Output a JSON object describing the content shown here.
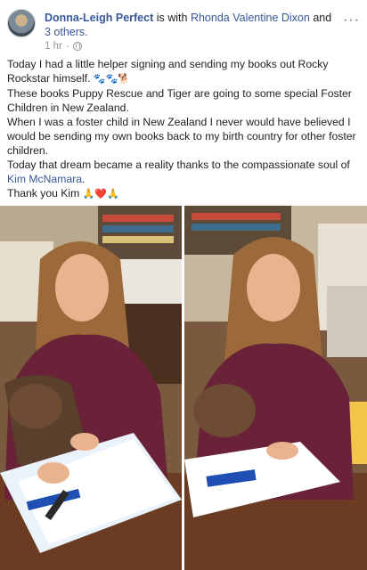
{
  "post": {
    "author": "Donna-Leigh Perfect",
    "with_text": "is with",
    "tagged_name": "Rhonda Valentine Dixon",
    "and_text": "and",
    "others_text": "3 others.",
    "timestamp": "1 hr",
    "separator": "·",
    "more_label": "···",
    "paragraphs": {
      "p1": "Today I had a little helper signing and sending my books out Rocky Rockstar himself.",
      "p1_emoji": "🐾🐾🐕",
      "p2": "These books Puppy Rescue and Tiger are going to some special Foster Children in New Zealand.",
      "p3": "When I was a foster child in New Zealand I never would have believed I would be sending my own books back to my birth country for other foster children.",
      "p4_before": "Today that dream became a reality thanks to the compassionate soul of",
      "p4_mention": "Kim McNamara",
      "p4_after": ".",
      "p5_text": "Thank you Kim",
      "p5_emoji": "🙏❤️🙏"
    }
  },
  "icons": {
    "avatar": "avatar-photo",
    "privacy": "globe-icon",
    "more": "more-options-icon"
  },
  "colors": {
    "link": "#365899",
    "meta": "#90949c",
    "text": "#1c1e21"
  }
}
